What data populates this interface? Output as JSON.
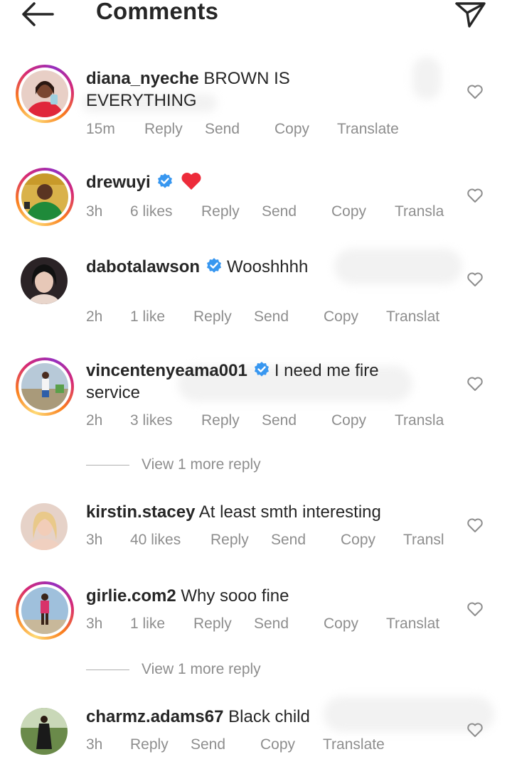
{
  "header": {
    "title": "Comments"
  },
  "comments": [
    {
      "username": "diana_nyeche",
      "text": "BROWN IS EVERYTHING",
      "verified": false,
      "time": "15m",
      "likes": "",
      "reply": "Reply",
      "send": "Send",
      "copy": "Copy",
      "translate": "Translate"
    },
    {
      "username": "drewuyi",
      "text": "",
      "verified": true,
      "time": "3h",
      "likes": "6 likes",
      "reply": "Reply",
      "send": "Send",
      "copy": "Copy",
      "translate": "Transla"
    },
    {
      "username": "dabotalawson",
      "text": "Wooshhhh",
      "verified": true,
      "time": "2h",
      "likes": "1 like",
      "reply": "Reply",
      "send": "Send",
      "copy": "Copy",
      "translate": "Translat"
    },
    {
      "username": "vincentenyeama001",
      "text": "I need me fire",
      "text2": "service",
      "verified": true,
      "time": "2h",
      "likes": "3 likes",
      "reply": "Reply",
      "send": "Send",
      "copy": "Copy",
      "translate": "Transla"
    },
    {
      "username": "kirstin.stacey",
      "text": "At least smth interesting",
      "verified": false,
      "time": "3h",
      "likes": "40 likes",
      "reply": "Reply",
      "send": "Send",
      "copy": "Copy",
      "translate": "Transl"
    },
    {
      "username": "girlie.com2",
      "text": "Why sooo fine",
      "verified": false,
      "time": "3h",
      "likes": "1 like",
      "reply": "Reply",
      "send": "Send",
      "copy": "Copy",
      "translate": "Translat"
    },
    {
      "username": "charmz.adams67",
      "text": "Black child",
      "verified": false,
      "time": "3h",
      "likes": "",
      "reply": "Reply",
      "send": "Send",
      "copy": "Copy",
      "translate": "Translate"
    }
  ],
  "view_more_1": "View 1 more reply",
  "view_more_2": "View 1 more reply",
  "colors": {
    "text": "#262626",
    "muted": "#8e8e8e",
    "verified": "#3897f0",
    "heart": "#ed4956"
  },
  "icons": [
    "back-arrow-icon",
    "direct-send-icon",
    "verified-badge-icon",
    "heart-outline-icon",
    "red-heart-emoji"
  ]
}
